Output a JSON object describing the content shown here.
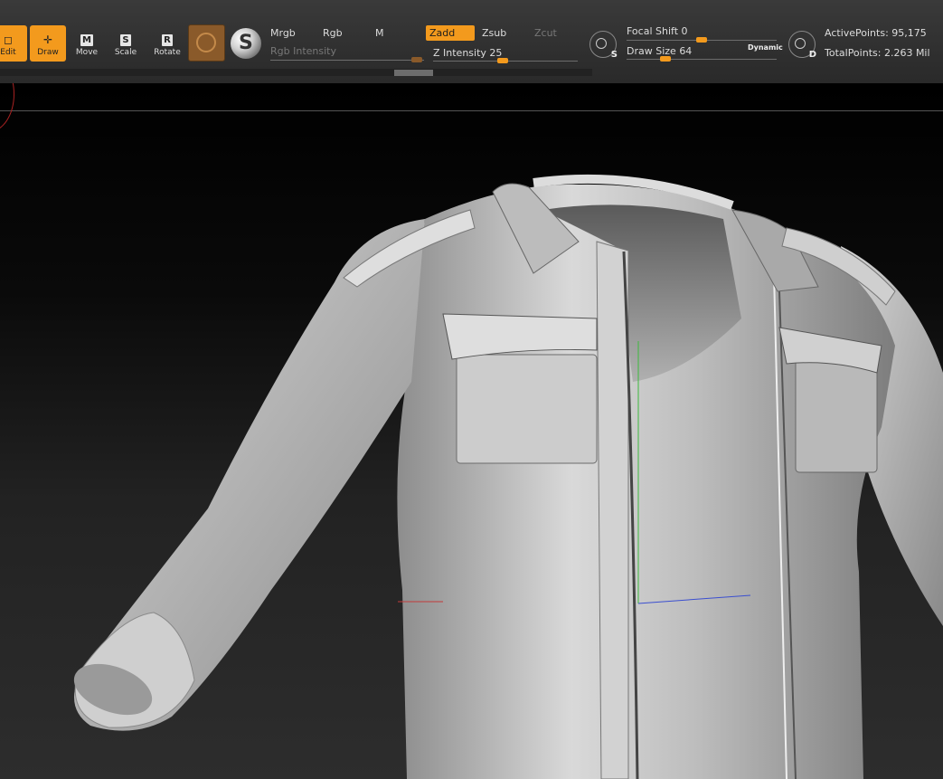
{
  "toolbar": {
    "tools": [
      {
        "label": "Edit",
        "key": "",
        "active": true
      },
      {
        "label": "Draw",
        "key": "",
        "active": true
      },
      {
        "label": "Move",
        "key": "M",
        "active": false
      },
      {
        "label": "Scale",
        "key": "S",
        "active": false
      },
      {
        "label": "Rotate",
        "key": "R",
        "active": false
      }
    ],
    "modes": {
      "mrgb": "Mrgb",
      "rgb": "Rgb",
      "m": "M",
      "zadd": "Zadd",
      "zsub": "Zsub",
      "zcut": "Zcut"
    },
    "rgb_intensity": {
      "label": "Rgb Intensity",
      "value": ""
    },
    "z_intensity": {
      "label": "Z Intensity",
      "value": "25"
    },
    "focal_shift": {
      "label": "Focal Shift",
      "value": "0"
    },
    "draw_size": {
      "label": "Draw Size",
      "value": "64"
    },
    "dynamic_label": "Dynamic",
    "lightbox_s": "S",
    "lightbox_d": "D",
    "active_points": {
      "label": "ActivePoints:",
      "value": "95,175"
    },
    "total_points": {
      "label": "TotalPoints:",
      "value": "2.263 Mil"
    }
  },
  "icons": {
    "brush": "standard-brush-icon",
    "material": "matcap-sphere-icon",
    "stroke": "dynamic-stroke-icon",
    "draw": "crosshair-icon"
  },
  "colors": {
    "accent": "#f39a1d",
    "toolbar_bg": "#333333",
    "model": "#c8c8c8"
  }
}
